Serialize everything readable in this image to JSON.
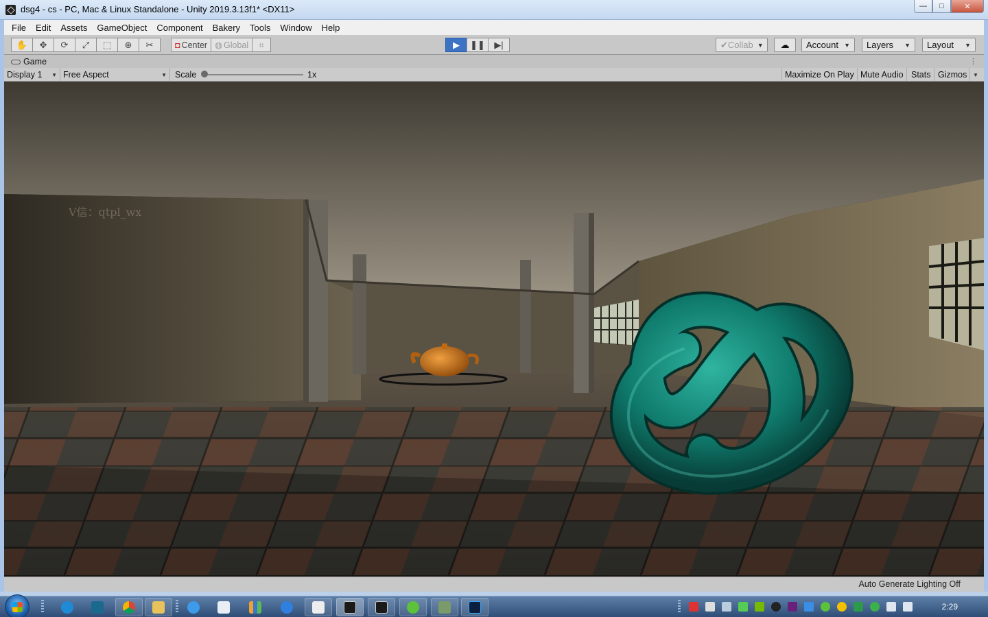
{
  "window": {
    "title": "dsg4 - cs - PC, Mac & Linux Standalone - Unity 2019.3.13f1* <DX11>",
    "controls": {
      "minimize": "—",
      "maximize": "□",
      "close": "✕"
    }
  },
  "menu": [
    "File",
    "Edit",
    "Assets",
    "GameObject",
    "Component",
    "Bakery",
    "Tools",
    "Window",
    "Help"
  ],
  "toolbar": {
    "pivot_label": "Center",
    "space_label": "Global",
    "collab_label": "Collab",
    "account_label": "Account",
    "layers_label": "Layers",
    "layout_label": "Layout",
    "play_state": "playing",
    "icons": [
      "hand-tool-icon",
      "move-tool-icon",
      "rotate-tool-icon",
      "scale-tool-icon",
      "rect-tool-icon",
      "transform-tool-icon",
      "custom-tool-icon",
      "play-icon",
      "pause-icon",
      "step-icon",
      "cloud-icon"
    ]
  },
  "game_tab": {
    "label": "Game",
    "display": "Display 1",
    "aspect": "Free Aspect",
    "scale_label": "Scale",
    "scale_value": "1x",
    "scale_fraction": 0,
    "maximize_label": "Maximize On Play",
    "mute_label": "Mute Audio",
    "stats_label": "Stats",
    "gizmos_label": "Gizmos"
  },
  "scene": {
    "watermark": "V信：qtpl_wx",
    "colors": {
      "knot": "#0f7a6c",
      "teapot": "#c06a14",
      "ceiling": "#8a8374",
      "floor_a": "#4b3a30",
      "floor_b": "#3a3a35"
    }
  },
  "status": {
    "text": "Auto Generate Lighting Off"
  },
  "taskbar": {
    "clock": "2:29",
    "apps": [
      "ie-icon",
      "app-icon",
      "chrome-icon",
      "explorer-icon",
      "cloud-app-icon",
      "mail-icon",
      "chart-app-icon",
      "sync-icon",
      "unity-icon",
      "unity-icon",
      "unity-icon",
      "wechat-icon",
      "monitor-icon",
      "photoshop-icon"
    ]
  }
}
